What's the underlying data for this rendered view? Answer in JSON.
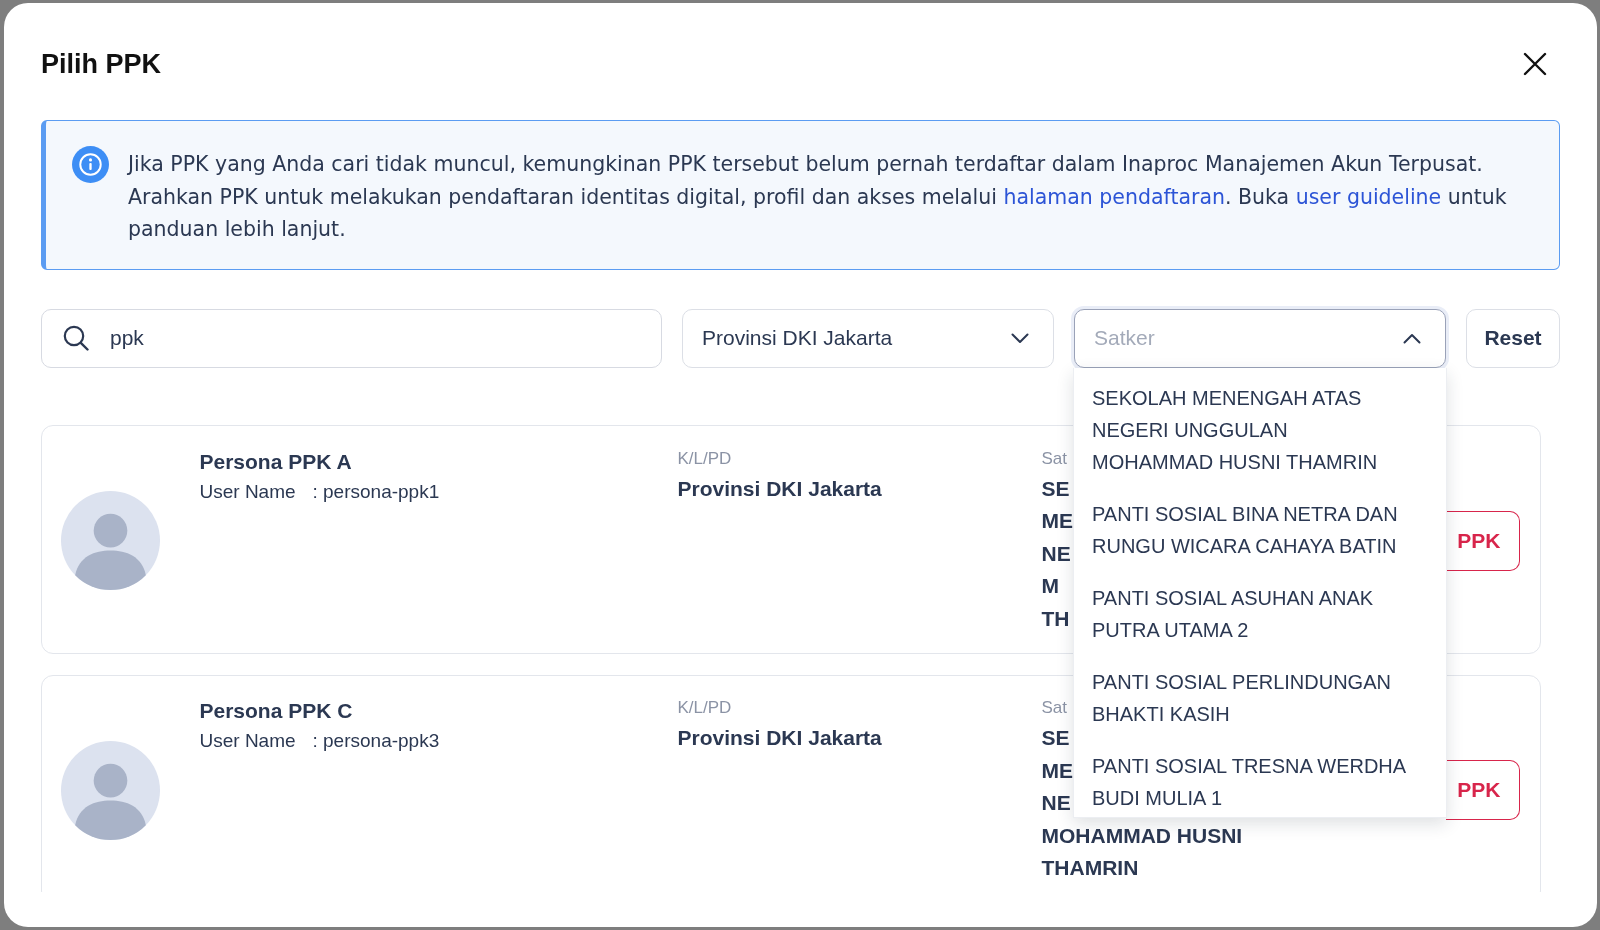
{
  "dialog": {
    "title": "Pilih PPK"
  },
  "info_banner": {
    "parts": [
      {
        "kind": "text",
        "text": "Jika PPK yang Anda cari tidak muncul, kemungkinan PPK tersebut belum pernah terdaftar dalam Inaproc Manajemen Akun Terpusat. Arahkan PPK untuk melakukan pendaftaran identitas digital, profil dan akses melalui "
      },
      {
        "kind": "link",
        "text": "halaman pendaftaran"
      },
      {
        "kind": "text",
        "text": ". Buka "
      },
      {
        "kind": "link",
        "text": "user guideline"
      },
      {
        "kind": "text",
        "text": " untuk panduan lebih lanjut."
      }
    ]
  },
  "filters": {
    "search": {
      "value": "ppk"
    },
    "selects": [
      {
        "value": "Provinsi DKI Jakarta",
        "expanded": false
      },
      {
        "placeholder": "Satker",
        "expanded": true,
        "options": [
          {
            "label": "SEKOLAH MENENGAH ATAS NEGERI UNGGULAN MOHAMMAD HUSNI THAMRIN",
            "selected": false
          },
          {
            "label": "PANTI SOSIAL BINA NETRA DAN RUNGU WICARA CAHAYA BATIN",
            "selected": false
          },
          {
            "label": "PANTI SOSIAL ASUHAN ANAK PUTRA UTAMA 2",
            "selected": false
          },
          {
            "label": "PANTI SOSIAL PERLINDUNGAN BHAKTI KASIH",
            "selected": false
          },
          {
            "label": "PANTI SOSIAL TRESNA WERDHA BUDI MULIA 1",
            "selected": false
          }
        ]
      }
    ],
    "reset_button": "Reset"
  },
  "results": [
    {
      "name": "Persona PPK A",
      "username_label": "User Name",
      "username": ": persona-ppk1",
      "klpd_label": "K/L/PD",
      "klpd": "Provinsi DKI Jakarta",
      "satker_label": "Sat",
      "satker_lines": [
        "SE",
        "ME",
        "NE",
        "M",
        "TH"
      ],
      "button_label": "PPK"
    },
    {
      "name": "Persona PPK C",
      "username_label": "User Name",
      "username": ": persona-ppk3",
      "klpd_label": "K/L/PD",
      "klpd": "Provinsi DKI Jakarta",
      "satker_label": "Sat",
      "satker_lines": [
        "SE",
        "ME",
        "NE",
        "MOHAMMAD HUSNI",
        "THAMRIN"
      ],
      "button_label": "PPK"
    }
  ]
}
